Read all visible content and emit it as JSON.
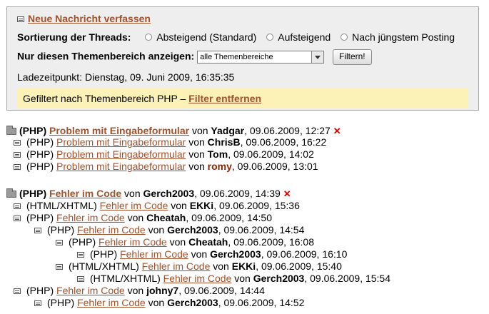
{
  "panel": {
    "new_message": "Neue Nachricht verfassen",
    "sort_label": "Sortierung der Threads:",
    "sort_options": [
      "Absteigend (Standard)",
      "Aufsteigend",
      "Nach jüngstem Posting"
    ],
    "filter_label": "Nur diesen Themenbereich anzeigen:",
    "filter_select_value": "alle Themenbereiche",
    "filter_button": "Filtern!",
    "load_time": "Ladezeitpunkt: Dienstag, 09. Juni 2009, 16:35:35",
    "filter_notice_prefix": "Gefiltert nach Themenbereich PHP –",
    "filter_remove_link": "Filter entfernen"
  },
  "threads": [
    {
      "root": {
        "category": "(PHP)",
        "title": "Problem mit Eingabeformular",
        "by": "von",
        "author": "Yadgar",
        "date": ", 09.06.2009, 12:27"
      },
      "replies": [
        {
          "category": "(PHP)",
          "title": "Problem mit Eingabeformular",
          "by": "von",
          "author": "ChrisB",
          "date": ", 09.06.2009, 16:22"
        },
        {
          "category": "(PHP)",
          "title": "Problem mit Eingabeformular",
          "by": "von",
          "author": "Tom",
          "date": ", 09.06.2009, 14:02"
        },
        {
          "category": "(PHP)",
          "title": "Problem mit Eingabeformular",
          "by": "von",
          "author": "romy",
          "date": ", 09.06.2009, 13:01"
        }
      ]
    },
    {
      "root": {
        "category": "(PHP)",
        "title": "Fehler im Code",
        "by": "von",
        "author": "Gerch2003",
        "date": ", 09.06.2009, 14:39"
      },
      "replies": [
        {
          "category": "(HTML/XHTML)",
          "title": "Fehler im Code",
          "by": "von",
          "author": "EKKi",
          "date": ", 09.06.2009, 15:36"
        },
        {
          "category": "(PHP)",
          "title": "Fehler im Code",
          "by": "von",
          "author": "Cheatah",
          "date": ", 09.06.2009, 14:50"
        },
        {
          "category": "(PHP)",
          "title": "Fehler im Code",
          "by": "von",
          "author": "Gerch2003",
          "date": ", 09.06.2009, 14:54"
        },
        {
          "category": "(PHP)",
          "title": "Fehler im Code",
          "by": "von",
          "author": "Cheatah",
          "date": ", 09.06.2009, 16:08"
        },
        {
          "category": "(PHP)",
          "title": "Fehler im Code",
          "by": "von",
          "author": "Gerch2003",
          "date": ", 09.06.2009, 16:10"
        },
        {
          "category": "(HTML/XHTML)",
          "title": "Fehler im Code",
          "by": "von",
          "author": "EKKi",
          "date": ", 09.06.2009, 15:40"
        },
        {
          "category": "(HTML/XHTML)",
          "title": "Fehler im Code",
          "by": "von",
          "author": "Gerch2003",
          "date": ", 09.06.2009, 15:54"
        },
        {
          "category": "(PHP)",
          "title": "Fehler im Code",
          "by": "von",
          "author": "johny7",
          "date": ", 09.06.2009, 14:44"
        },
        {
          "category": "(PHP)",
          "title": "Fehler im Code",
          "by": "von",
          "author": "Gerch2003",
          "date": ", 09.06.2009, 14:52"
        }
      ]
    }
  ],
  "icons": {
    "new_message": "document-icon",
    "thread": "folder-icon",
    "reply": "document-icon",
    "delete": "red-x-icon"
  }
}
